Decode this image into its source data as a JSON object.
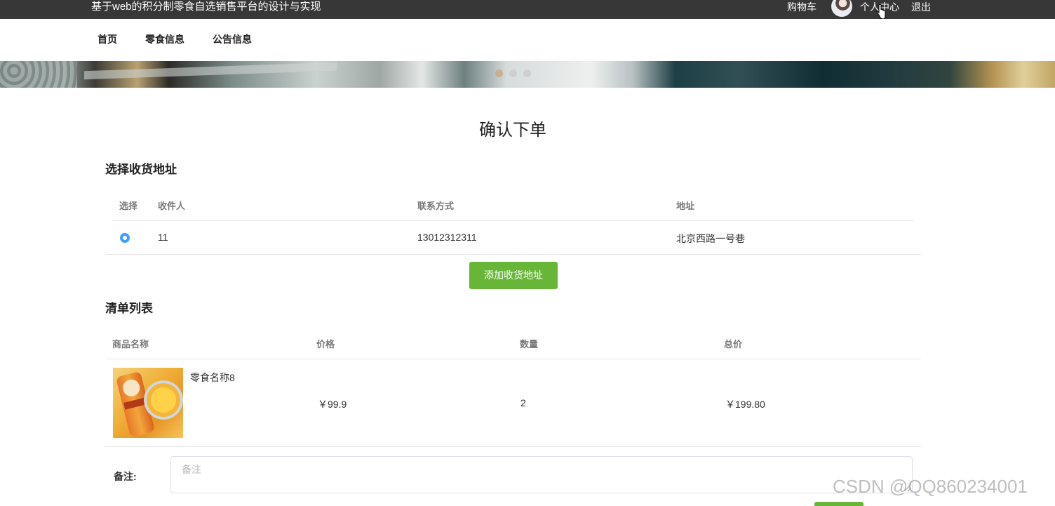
{
  "topbar": {
    "site_title": "基于web的积分制零食自选销售平台的设计与实现",
    "cart": "购物车",
    "profile": "个人中心",
    "logout": "退出"
  },
  "nav": {
    "items": [
      {
        "label": "首页"
      },
      {
        "label": "零食信息"
      },
      {
        "label": "公告信息"
      }
    ]
  },
  "banner": {
    "slide_count": 3,
    "active_slide": 1
  },
  "page": {
    "title": "确认下单"
  },
  "address_section": {
    "title": "选择收货地址",
    "columns": [
      "选择",
      "收件人",
      "联系方式",
      "地址"
    ],
    "rows": [
      {
        "selected": true,
        "recipient": "11",
        "phone": "13012312311",
        "address": "北京西路一号巷"
      }
    ],
    "add_button": "添加收货地址"
  },
  "order_section": {
    "title": "清单列表",
    "columns": [
      "商品名称",
      "价格",
      "数量",
      "总价"
    ],
    "items": [
      {
        "name": "零食名称8",
        "price": "￥99.9",
        "quantity": "2",
        "total": "￥199.80"
      }
    ]
  },
  "remark": {
    "label": "备注:",
    "placeholder": "备注",
    "value": ""
  },
  "watermark": "CSDN @QQ860234001",
  "colors": {
    "topbar": "#373737",
    "accent_green": "#67b637",
    "radio_blue": "#409eff"
  }
}
